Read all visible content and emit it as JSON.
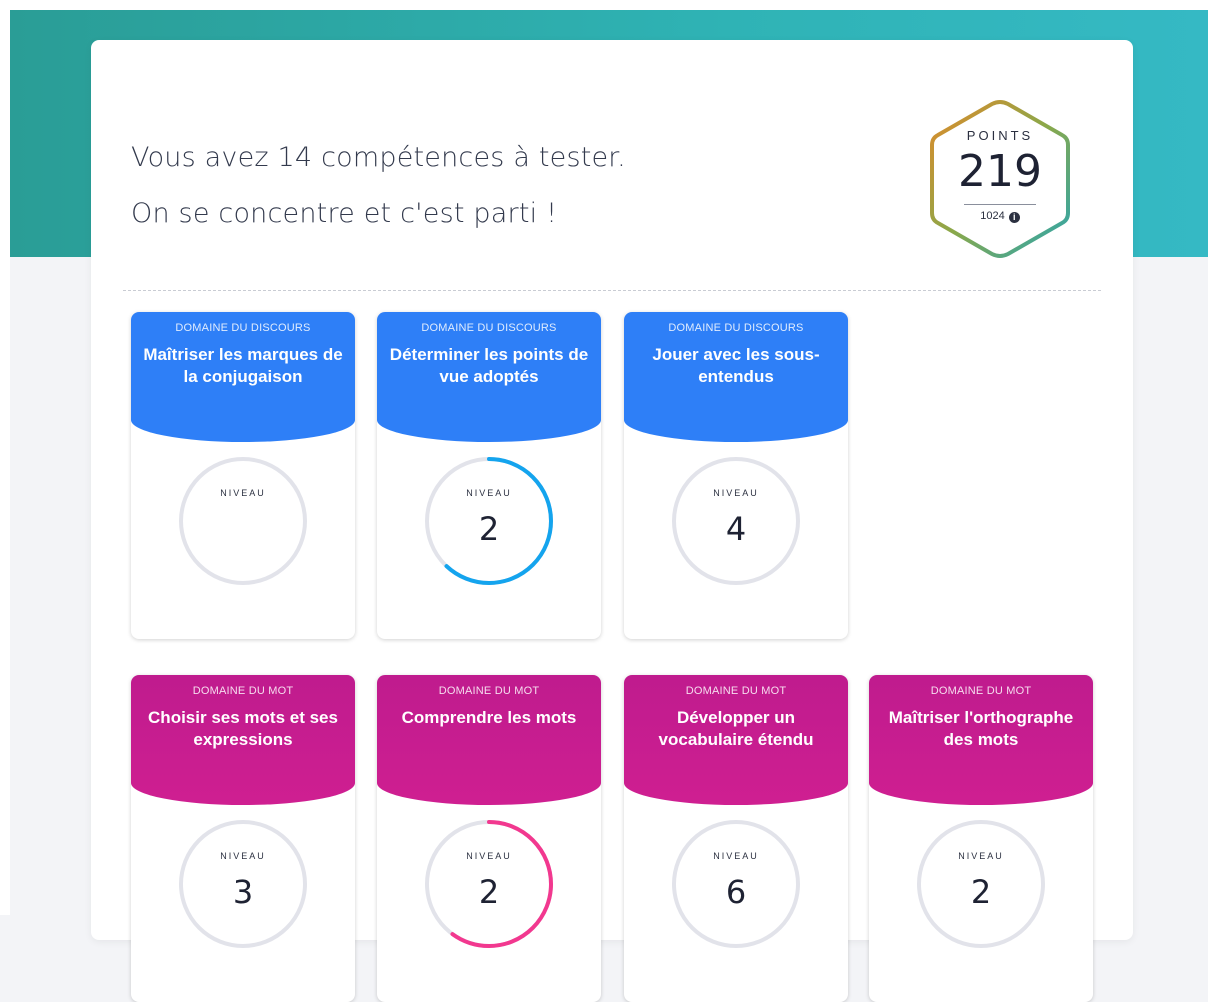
{
  "header": {
    "line1": "Vous avez 14 compétences à tester.",
    "line2": "On se concentre et c'est parti !"
  },
  "points": {
    "label": "POINTS",
    "value": "219",
    "total": "1024",
    "info_icon": "info-icon"
  },
  "level_label": "NIVEAU",
  "colors": {
    "banner": "#2fb3b5",
    "blue": "#2e7ff7",
    "pink": "#c71c8f",
    "ring_track": "#e2e3ea",
    "ring_blue": "#14a4ee",
    "ring_pink": "#f2388f"
  },
  "cards": [
    {
      "domain": "DOMAINE DU DISCOURS",
      "title": "Maîtriser les marques de la conjugaison",
      "level": "",
      "progress": 0,
      "color": "blue"
    },
    {
      "domain": "DOMAINE DU DISCOURS",
      "title": "Déterminer les points de vue adoptés",
      "level": "2",
      "progress": 0.62,
      "color": "blue"
    },
    {
      "domain": "DOMAINE DU DISCOURS",
      "title": "Jouer avec les sous-entendus",
      "level": "4",
      "progress": 0,
      "color": "blue"
    },
    {
      "domain": "DOMAINE DU MOT",
      "title": "Choisir ses mots et ses expressions",
      "level": "3",
      "progress": 0,
      "color": "pink"
    },
    {
      "domain": "DOMAINE DU MOT",
      "title": "Comprendre les mots",
      "level": "2",
      "progress": 0.6,
      "color": "pink"
    },
    {
      "domain": "DOMAINE DU MOT",
      "title": "Développer un vocabulaire étendu",
      "level": "6",
      "progress": 0,
      "color": "pink"
    },
    {
      "domain": "DOMAINE DU MOT",
      "title": "Maîtriser l'orthographe des mots",
      "level": "2",
      "progress": 0,
      "color": "pink"
    }
  ]
}
